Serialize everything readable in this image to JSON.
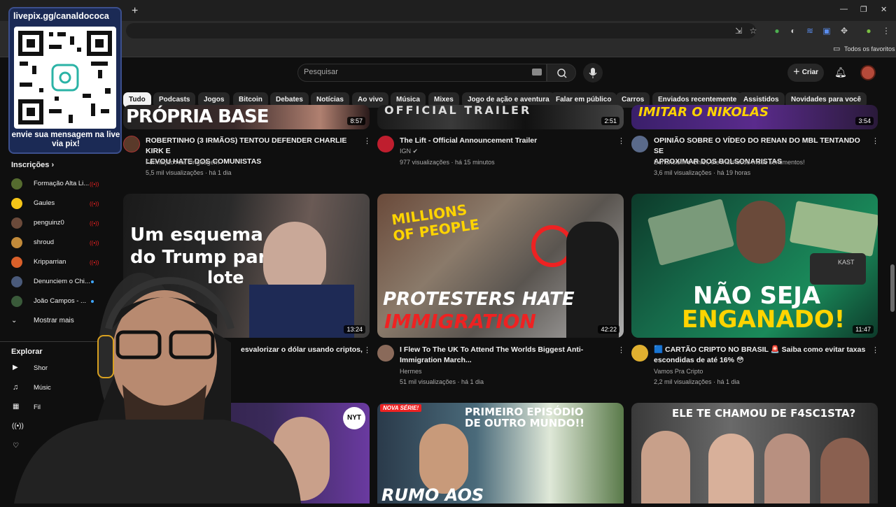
{
  "overlay": {
    "title": "livepix.gg/canaldococa",
    "message": "envie sua mensagem na live via pix!"
  },
  "browser": {
    "new_tab": "+",
    "bookmarks_label": "Todos os favoritos"
  },
  "header": {
    "search_placeholder": "Pesquisar",
    "create_label": "Criar"
  },
  "chips": [
    "Tudo",
    "Podcasts",
    "Jogos",
    "Bitcoin",
    "Debates",
    "Notícias",
    "Ao vivo",
    "Música",
    "Mixes",
    "Jogo de ação e aventura",
    "Falar em público",
    "Carros",
    "Enviados recentemente",
    "Assistidos",
    "Novidades para você"
  ],
  "sidebar": {
    "subscriptions_label": "Inscrições",
    "subscriptions": [
      {
        "name": "Formação Alta Li...",
        "color": "#556b2f",
        "status": "live"
      },
      {
        "name": "Gaules",
        "color": "#f5c518",
        "status": "live"
      },
      {
        "name": "penguinz0",
        "color": "#6b4a3a",
        "status": "live"
      },
      {
        "name": "shroud",
        "color": "#c28a3a",
        "status": "live"
      },
      {
        "name": "Kripparrian",
        "color": "#d9602a",
        "status": "live"
      },
      {
        "name": "Denunciem o Chi...",
        "color": "#4a5a7a",
        "status": "new"
      },
      {
        "name": "João Campos - ...",
        "color": "#3a5a3a",
        "status": "new"
      }
    ],
    "show_more": "Mostrar mais",
    "explore_label": "Explorar",
    "explore_items": [
      "Shor",
      "Músic",
      "Fil"
    ]
  },
  "videos": [
    {
      "title_line1": "ROBERTINHO (3 IRMÃOS) TENTOU DEFENDER CHARLIE KIRK E",
      "title_line2": "LEVOU HATE DOS COMUNISTAS",
      "channel": "Formação Alta Linguagem",
      "meta": "5,5 mil visualizações · há 1 dia",
      "duration": "8:57",
      "thumb_text": "PRÓPRIA BASE"
    },
    {
      "title_line1": "The Lift - Official Announcement Trailer",
      "title_line2": "",
      "channel": "IGN",
      "meta": "977 visualizações · há 15 minutos",
      "duration": "2:51",
      "thumb_text": "OFFICIAL TRAILER"
    },
    {
      "title_line1": "OPINIÃO SOBRE O VÍDEO DO RENAN DO MBL TENTANDO SE",
      "title_line2": "APROXIMAR DOS BOLSONARISTAS",
      "channel": "Denunciem o Chief, ele machucou meus sentimentos!",
      "meta": "3,6 mil visualizações · há 19 horas",
      "duration": "3:54",
      "thumb_text": "IMITAR O NIKOLAS"
    },
    {
      "title_line1": "esvalorizar o dólar usando criptos,",
      "title_line2": "",
      "channel": "",
      "meta": "",
      "duration": "13:24",
      "thumb_text_1": "Um esquema",
      "thumb_text_2": "do Trump para",
      "thumb_text_3": "lote"
    },
    {
      "title_line1": "I Flew To The UK To Attend The Worlds Biggest Anti-",
      "title_line2": "Immigration March...",
      "channel": "Hermes",
      "meta": "51 mil visualizações · há 1 dia",
      "duration": "42:22",
      "thumb_text_1": "MILLIONS",
      "thumb_text_2": "OF PEOPLE",
      "thumb_text_3": "PROTESTERS HATE",
      "thumb_text_4": "IMMIGRATION"
    },
    {
      "title_line1": "🟦 CARTÃO CRIPTO NO BRASIL 🚨 Saiba como evitar taxas",
      "title_line2": "escondidas de até 16% 😳",
      "channel": "Vamos Pra Cripto",
      "meta": "2,2 mil visualizações · há 1 dia",
      "duration": "11:47",
      "thumb_text_1": "NÃO SEJA",
      "thumb_text_2": "ENGANADO!",
      "thumb_text_3": "KAST"
    },
    {
      "thumb_text_1": "NYT"
    },
    {
      "thumb_text_1": "NOVA SÉRIE!",
      "thumb_text_2": "PRIMEIRO EPISÓDIO",
      "thumb_text_3": "DE OUTRO MUNDO!!",
      "thumb_text_4": "RUMO AOS"
    },
    {
      "thumb_text_1": "ELE TE CHAMOU DE F4SC1STA?"
    }
  ]
}
